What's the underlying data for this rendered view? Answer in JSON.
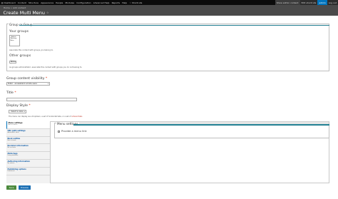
{
  "toolbar": {
    "left_items": [
      {
        "label": "Dashboard",
        "icon": "grid-icon"
      },
      {
        "label": "Content",
        "icon": ""
      },
      {
        "label": "Structure",
        "icon": ""
      },
      {
        "label": "Appearance",
        "icon": ""
      },
      {
        "label": "People",
        "icon": ""
      },
      {
        "label": "Modules",
        "icon": ""
      },
      {
        "label": "Configuration",
        "icon": ""
      },
      {
        "label": "Advanced Help",
        "icon": ""
      },
      {
        "label": "Reports",
        "icon": ""
      },
      {
        "label": "Help",
        "icon": ""
      },
      {
        "label": "Shortcuts",
        "icon": "star-icon"
      }
    ],
    "right_items": [
      "Show admin content",
      "Edit shortcuts",
      "admin",
      "Log out"
    ]
  },
  "header": {
    "breadcrumbs": [
      "Home",
      "»",
      "Add content"
    ],
    "title": "Create Multi Menu",
    "star": "☆"
  },
  "groups": {
    "legend": "Group or Group",
    "your_groups_title": "Your groups",
    "your_groups_options": [
      "- Admin",
      "Working",
      "Beta"
    ],
    "your_groups_desc": "Associate this content with groups you belong to.",
    "other_groups_title": "Other groups",
    "other_groups_select": "- None -",
    "other_groups_desc": "As groups administrator, associate this content with groups you do not belong to."
  },
  "visibility": {
    "label": "Group content visibility",
    "required": "*",
    "value": "Public - accessible to all site users"
  },
  "title_field": {
    "label": "Title",
    "required": "*"
  },
  "display_style": {
    "label": "Display Style",
    "required": "*",
    "value": "- Select a value -",
    "desc_before": "The menu can display as a dropdown, a set of horizontal tabs, or a set of",
    "desc_link": "ordered tabs"
  },
  "vertical_tabs": [
    {
      "title": "Menu settings",
      "summary": "Not in menu",
      "active": true
    },
    {
      "title": "URL path settings",
      "summary": "Automatic alias",
      "active": false
    },
    {
      "title": "Book outline",
      "summary": "Not in book",
      "active": false
    },
    {
      "title": "Revision information",
      "summary": "No revision",
      "active": false
    },
    {
      "title": "Meta tags",
      "summary": "Using defaults",
      "active": false
    },
    {
      "title": "Authoring information",
      "summary": "By admin",
      "active": false
    },
    {
      "title": "Publishing options",
      "summary": "Published",
      "active": false
    }
  ],
  "menu_settings": {
    "legend": "Menu settings",
    "checkbox_label": "Provide a menu link"
  },
  "actions": {
    "save": "Save",
    "preview": "Preview"
  }
}
